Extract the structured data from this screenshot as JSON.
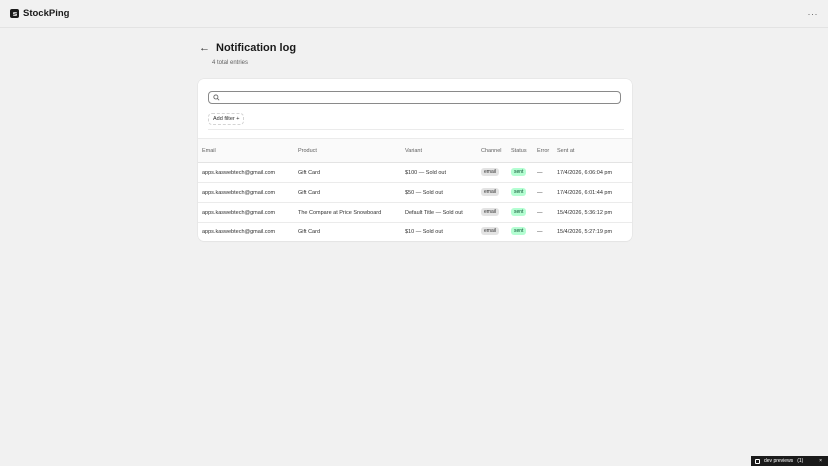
{
  "app": {
    "name": "StockPing",
    "more_label": "···"
  },
  "page": {
    "back_label": "←",
    "title": "Notification log",
    "subtitle": "4 total entries"
  },
  "search": {
    "placeholder": ""
  },
  "filter": {
    "label": "Add filter +"
  },
  "table": {
    "columns": {
      "email": "Email",
      "product": "Product",
      "variant": "Variant",
      "channel": "Channel",
      "status": "Status",
      "error": "Error",
      "sent_at": "Sent at"
    },
    "rows": [
      {
        "email": "apps.kaswebtech@gmail.com",
        "product": "Gift Card",
        "variant": "$100 — Sold out",
        "channel": "email",
        "status": "sent",
        "error": "—",
        "sent_at": "17/4/2026, 6:06:04 pm"
      },
      {
        "email": "apps.kaswebtech@gmail.com",
        "product": "Gift Card",
        "variant": "$50 — Sold out",
        "channel": "email",
        "status": "sent",
        "error": "—",
        "sent_at": "17/4/2026, 6:01:44 pm"
      },
      {
        "email": "apps.kaswebtech@gmail.com",
        "product": "The Compare at Price Snowboard",
        "variant": "Default Title — Sold out",
        "channel": "email",
        "status": "sent",
        "error": "—",
        "sent_at": "15/4/2026, 5:36:12 pm"
      },
      {
        "email": "apps.kaswebtech@gmail.com",
        "product": "Gift Card",
        "variant": "$10 — Sold out",
        "channel": "email",
        "status": "sent",
        "error": "—",
        "sent_at": "15/4/2026, 5:27:19 pm"
      }
    ]
  },
  "dev_bar": {
    "label": "dev previews",
    "count": "(1)",
    "close": "×"
  },
  "colors": {
    "status_sent_bg": "#b4fed2",
    "status_sent_text": "#0c5132",
    "channel_bg": "#e3e3e3"
  }
}
